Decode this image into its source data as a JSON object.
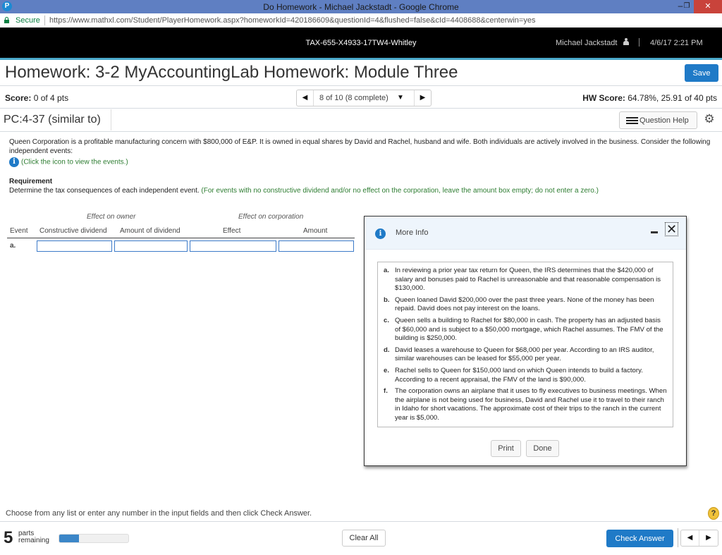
{
  "browser": {
    "window_title": "Do Homework - Michael Jackstadt - Google Chrome",
    "app_icon_letter": "P",
    "minimize_glyph": "–",
    "maximize_glyph": "❐",
    "close_glyph": "✕",
    "secure_label": "Secure",
    "url": "https://www.mathxl.com/Student/PlayerHomework.aspx?homeworkId=420186609&questionId=4&flushed=false&cId=4408688&centerwin=yes"
  },
  "header": {
    "course_id": "TAX-655-X4933-17TW4-Whitley",
    "user_name": "Michael Jackstadt",
    "datetime": "4/6/17 2:21 PM"
  },
  "homework": {
    "title": "Homework: 3-2 MyAccountingLab Homework: Module Three",
    "save_label": "Save",
    "score_label": "Score:",
    "score_value": "0 of 4 pts",
    "question_nav": {
      "prev_glyph": "◀",
      "next_glyph": "▶",
      "label": "8 of 10 (8 complete)",
      "caret_glyph": "▼"
    },
    "hw_score_label": "HW Score:",
    "hw_score_value": "64.78%, 25.91 of 40 pts",
    "problem_title": "PC:4-37 (similar to)",
    "question_help_label": "Question Help"
  },
  "question": {
    "intro": "Queen Corporation is a profitable manufacturing concern with $800,000 of E&P. It is owned in equal shares by David and Rachel, husband and wife. Both individuals are actively involved in the business. Consider the following independent events:",
    "info_link": "(Click the icon to view the events.)",
    "requirement_heading": "Requirement",
    "requirement_text": "Determine the tax consequences of each independent event.",
    "requirement_note": "(For events with no constructive dividend and/or no effect on the corporation, leave the amount box empty; do not enter a zero.)"
  },
  "answer_table": {
    "group_headers": [
      "Effect on owner",
      "Effect on corporation"
    ],
    "columns": [
      "Event",
      "Constructive dividend",
      "Amount of dividend",
      "Effect",
      "Amount"
    ],
    "rows": [
      {
        "event": "a.",
        "constructive_dividend": "",
        "amount_of_dividend": "",
        "effect": "",
        "amount": ""
      }
    ]
  },
  "modal": {
    "title": "More Info",
    "close_glyph": "✕",
    "events": [
      {
        "letter": "a.",
        "text": "In reviewing a prior year tax return for Queen, the IRS determines that the $420,000 of salary and bonuses paid to Rachel is unreasonable and that reasonable compensation is $130,000."
      },
      {
        "letter": "b.",
        "text": "Queen loaned David $200,000 over the past three years. None of the money has been repaid. David does not pay interest on the loans."
      },
      {
        "letter": "c.",
        "text": "Queen sells a building to Rachel for $80,000 in cash. The property has an adjusted basis of $60,000 and is subject to a $50,000 mortgage, which Rachel assumes. The FMV of the building is $250,000."
      },
      {
        "letter": "d.",
        "text": "David leases a warehouse to Queen for $68,000 per year. According to an IRS auditor, similar warehouses can be leased for $55,000 per year."
      },
      {
        "letter": "e.",
        "text": "Rachel sells to Queen for $150,000 land on which Queen intends to build a factory. According to a recent appraisal, the FMV of the land is $90,000."
      },
      {
        "letter": "f.",
        "text": "The corporation owns an airplane that it uses to fly executives to business meetings. When the airplane is not being used for business, David and Rachel use it to travel to their ranch in Idaho for short vacations. The approximate cost of their trips to the ranch in the current year is $5,000."
      }
    ],
    "print_label": "Print",
    "done_label": "Done"
  },
  "footer": {
    "instruction": "Choose from any list or enter any number in the input fields and then click Check Answer.",
    "help_glyph": "?",
    "parts_remaining_count": "5",
    "parts_label_line1": "parts",
    "parts_label_line2": "remaining",
    "progress_fraction": 0.29,
    "clear_all_label": "Clear All",
    "check_answer_label": "Check Answer",
    "prev_glyph": "◀",
    "next_glyph": "▶"
  },
  "colors": {
    "primary_blue": "#1f7ac7",
    "accent_line": "#49a8c9",
    "instruction_green": "#2e7d32",
    "secure_green": "#0b8043",
    "titlebar": "#5f7fc2",
    "close_red": "#c9433b"
  }
}
